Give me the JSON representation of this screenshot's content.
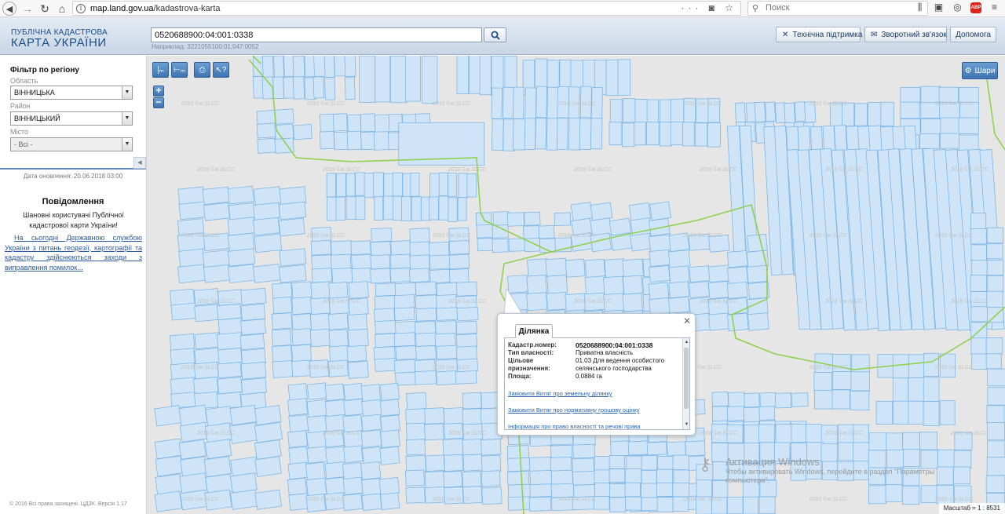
{
  "browser": {
    "url_host": "map.land.gov.ua",
    "url_path": "/kadastrova-karta",
    "search_placeholder": "Поиск",
    "abp_label": "ABP"
  },
  "header": {
    "logo_line1": "ПУБЛІЧНА КАДАСТРОВА",
    "logo_line2": "КАРТА УКРАЇНИ",
    "search_value": "0520688900:04:001:0338",
    "example_hint": "Наприклад: 3221055100:01:047:0052",
    "support_label": "Технічна підтримка",
    "feedback_label": "Зворотний зв'язок",
    "help_label": "Допомога"
  },
  "filter": {
    "title": "Фільтр по регіону",
    "region_label": "Область",
    "region_value": "ВІННИЦЬКА",
    "district_label": "Район",
    "district_value": "ВІННИЦЬКИЙ",
    "city_label": "Місто",
    "city_value": "- Всі -"
  },
  "sidebar": {
    "update_date": "Дата оновлення: 20.06.2018 03:00",
    "notice_title": "Повідомлення",
    "notice_greeting": "Шановні користувачі Публічної кадастрової карти України!",
    "notice_link": "На сьогодні Державною службою України з питань геодезії, картографії та кадастру здійснюються заходи з виправлення помилок...",
    "copyright": "© 2016 Всі права захищені. ЦДЗК. Версія 1.17"
  },
  "map": {
    "layers_label": "Шари",
    "watermark": "2018 ©ж.SLCC",
    "scale_text": "Масштаб = 1 : 8531"
  },
  "popup": {
    "tab_label": "Ділянка",
    "fields": [
      {
        "key": "Кадастр.номер:",
        "value": "0520688900:04:001:0338"
      },
      {
        "key": "Тип власності:",
        "value": "Приватна власність"
      },
      {
        "key": "Цільове призначення:",
        "value": "01.03 Для ведення особистого селянського господарства"
      },
      {
        "key": "Площа:",
        "value": "0.0884 га"
      }
    ],
    "links": [
      "Замовити Витяг про земельну ділянку",
      "Замовити Витяг про нормативну грошову оцінку",
      "Інформація про право власності та речові права"
    ]
  },
  "activation": {
    "title": "Активация Windows",
    "text": "Чтобы активировать Windows, перейдите в раздел \"Параметры компьютера\"."
  },
  "colors": {
    "map_bg": "#e6e6e6",
    "parcel_fill": "#cfe5f7",
    "parcel_stroke": "#7fb6e6",
    "boundary": "#8fd14f",
    "accent": "#3e74b3"
  }
}
